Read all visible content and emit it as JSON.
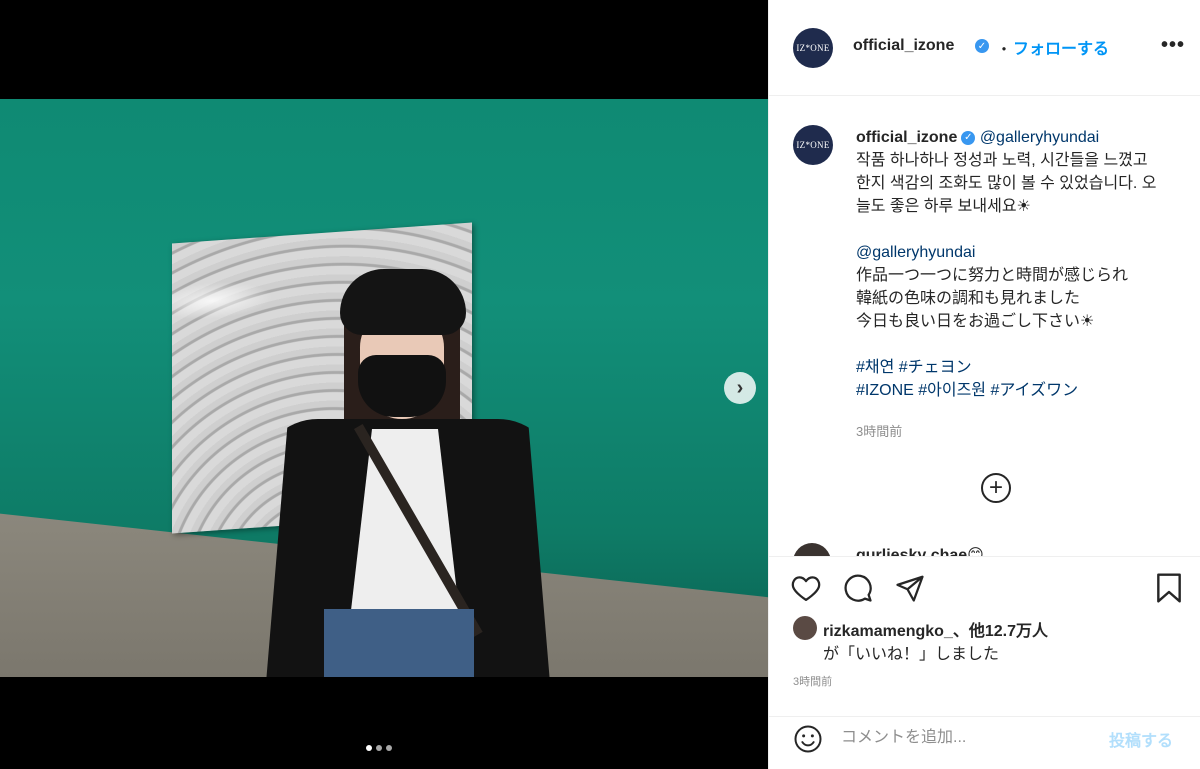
{
  "account": {
    "username": "official_izone",
    "avatar_text": "IZ*ONE",
    "verified": true
  },
  "header": {
    "separator": "・",
    "follow_label": "フォローする",
    "more_label": "•••"
  },
  "caption": {
    "mention": "@galleryhyundai",
    "korean_lines": [
      "작품 하나하나 정성과 노력, 시간들을 느꼈고",
      "한지 색감의 조화도 많이 볼 수 있었습니다. 오",
      "늘도 좋은 하루 보내세요☀"
    ],
    "japanese_mention": "@galleryhyundai",
    "japanese_lines": [
      "作品一つ一つに努力と時間が感じられ",
      "韓紙の色味の調和も見れました",
      "今日も良い日をお過ごし下さい☀"
    ],
    "hashtags_line1": "#채연 #チェヨン",
    "hashtags_line2": "#IZONE #아이즈원 #アイズワン",
    "time_ago": "3時間前"
  },
  "comment_peek": {
    "text": "gurliesky chae😊"
  },
  "likes": {
    "line1": "rizkamamengko_、他12.7万人",
    "line2": "が「いいね！」しました"
  },
  "post_time": "3時間前",
  "comment": {
    "placeholder": "コメントを追加...",
    "post_label": "投稿する"
  },
  "carousel": {
    "total_slides": 3,
    "current_slide": 1
  },
  "colors": {
    "accent": "#0095f6",
    "link": "#00376b",
    "post_disabled": "#b2dffc"
  }
}
